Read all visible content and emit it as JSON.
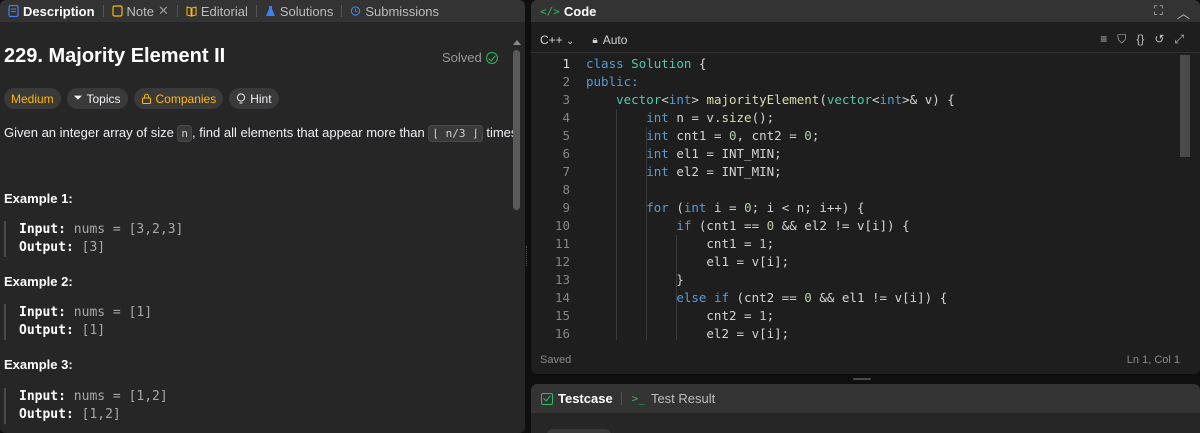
{
  "left_tabs": [
    {
      "label": "Description",
      "icon": "description-icon",
      "active": true
    },
    {
      "label": "Note",
      "icon": "note-icon",
      "active": false,
      "closable": true
    },
    {
      "label": "Editorial",
      "icon": "book-icon",
      "active": false
    },
    {
      "label": "Solutions",
      "icon": "flask-icon",
      "active": false
    },
    {
      "label": "Submissions",
      "icon": "history-icon",
      "active": false
    }
  ],
  "problem": {
    "title": "229. Majority Element II",
    "status": "Solved",
    "difficulty": "Medium",
    "chips": {
      "topics": "Topics",
      "companies": "Companies",
      "hint": "Hint"
    },
    "desc_before": "Given an integer array of size ",
    "desc_code1": "n",
    "desc_middle": ", find all elements that appear more than ",
    "desc_code2": "⌊ n/3 ⌋",
    "desc_after": " times."
  },
  "examples": [
    {
      "title": "Example 1:",
      "input_label": "Input:",
      "input": " nums = [3,2,3]",
      "output_label": "Output:",
      "output": " [3]"
    },
    {
      "title": "Example 2:",
      "input_label": "Input:",
      "input": " nums = [1]",
      "output_label": "Output:",
      "output": " [1]"
    },
    {
      "title": "Example 3:",
      "input_label": "Input:",
      "input": " nums = [1,2]",
      "output_label": "Output:",
      "output": " [1,2]"
    }
  ],
  "code_panel": {
    "title": "Code",
    "language": "C++",
    "mode": "Auto",
    "status_left": "Saved",
    "status_right": "Ln 1, Col 1"
  },
  "code_lines": [
    {
      "n": "1",
      "html": "<span class=\"kw\">class</span> <span class=\"ty\">Solution</span> {"
    },
    {
      "n": "2",
      "html": "<span class=\"lbl\">public:</span>"
    },
    {
      "n": "3",
      "html": "    <span class=\"ty\">vector</span>&lt;<span class=\"kw\">int</span>&gt; <span class=\"fn\">majorityElement</span>(<span class=\"ty\">vector</span>&lt;<span class=\"kw\">int</span>&gt;&amp; v) {"
    },
    {
      "n": "4",
      "html": "        <span class=\"kw\">int</span> n = v.<span class=\"fn\">size</span>();"
    },
    {
      "n": "5",
      "html": "        <span class=\"kw\">int</span> cnt1 = <span class=\"nm\">0</span>, cnt2 = <span class=\"nm\">0</span>;"
    },
    {
      "n": "6",
      "html": "        <span class=\"kw\">int</span> el1 = INT_MIN;"
    },
    {
      "n": "7",
      "html": "        <span class=\"kw\">int</span> el2 = INT_MIN;"
    },
    {
      "n": "8",
      "html": ""
    },
    {
      "n": "9",
      "html": "        <span class=\"kw\">for</span> (<span class=\"kw\">int</span> i = <span class=\"nm\">0</span>; i &lt; n; i++) {"
    },
    {
      "n": "10",
      "html": "            <span class=\"kw\">if</span> (cnt1 == <span class=\"nm\">0</span> &amp;&amp; el2 != v[i]) {"
    },
    {
      "n": "11",
      "html": "                cnt1 = <span class=\"nm\">1</span>;"
    },
    {
      "n": "12",
      "html": "                el1 = v[i];"
    },
    {
      "n": "13",
      "html": "            }"
    },
    {
      "n": "14",
      "html": "            <span class=\"kw\">else if</span> (cnt2 == <span class=\"nm\">0</span> &amp;&amp; el1 != v[i]) {"
    },
    {
      "n": "15",
      "html": "                cnt2 = <span class=\"nm\">1</span>;"
    },
    {
      "n": "16",
      "html": "                el2 = v[i];"
    }
  ],
  "test_tabs": {
    "testcase": "Testcase",
    "result": "Test Result"
  },
  "colors": {
    "accent_green": "#2cbb5d",
    "medium": "#ffb800",
    "keyword": "#569cd6",
    "type": "#4ec9b0"
  }
}
